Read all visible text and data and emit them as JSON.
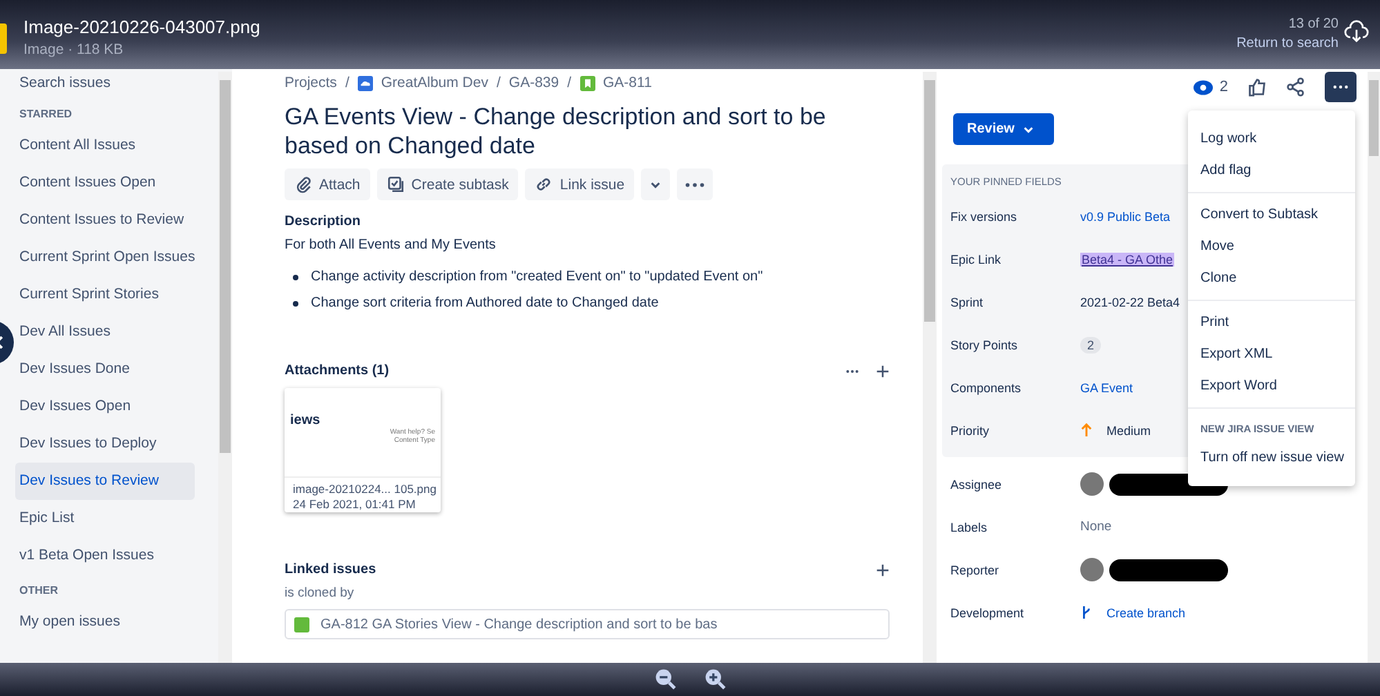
{
  "viewer": {
    "file_name": "Image-20210226-043007.png",
    "file_info": "Image · 118 KB",
    "position": "13 of 20",
    "return_link": "Return to search"
  },
  "sidebar": {
    "search": "Search issues",
    "sections": [
      {
        "heading": "STARRED",
        "items": [
          {
            "label": "Content All Issues",
            "selected": false
          },
          {
            "label": "Content Issues Open",
            "selected": false
          },
          {
            "label": "Content Issues to Review",
            "selected": false
          },
          {
            "label": "Current Sprint Open Issues",
            "selected": false
          },
          {
            "label": "Current Sprint Stories",
            "selected": false
          },
          {
            "label": "Dev All Issues",
            "selected": false
          },
          {
            "label": "Dev Issues Done",
            "selected": false
          },
          {
            "label": "Dev Issues Open",
            "selected": false
          },
          {
            "label": "Dev Issues to Deploy",
            "selected": false
          },
          {
            "label": "Dev Issues to Review",
            "selected": true
          },
          {
            "label": "Epic List",
            "selected": false
          },
          {
            "label": "v1 Beta Open Issues",
            "selected": false
          }
        ]
      },
      {
        "heading": "OTHER",
        "items": [
          {
            "label": "My open issues",
            "selected": false
          }
        ]
      }
    ]
  },
  "breadcrumbs": [
    {
      "label": "Projects",
      "kind": "plain"
    },
    {
      "separator": "/",
      "label": "GreatAlbum Dev",
      "kind": "project"
    },
    {
      "separator": "/",
      "label": "GA-839",
      "kind": "plain"
    },
    {
      "separator": "/",
      "label": "GA-811",
      "kind": "story"
    }
  ],
  "issue": {
    "title": "GA Events View - Change description and sort to be based on Changed date",
    "actions": [
      {
        "label": "Attach",
        "kind": "attach"
      },
      {
        "label": "Create subtask",
        "kind": "subtask"
      },
      {
        "label": "Link issue",
        "kind": "link"
      }
    ],
    "description_heading": "Description",
    "description_intro": "For both All Events and My Events",
    "description_bullets": [
      "Change activity description from \"created Event on\" to \"updated Event on\"",
      "Change sort criteria from Authored date to Changed date"
    ],
    "attachments_heading": "Attachments (1)",
    "attachment": {
      "preview_heading": "iews",
      "preview_note": "Want help? Se",
      "preview_column": "Content Type",
      "file_name": "image-20210224... 105.png",
      "date": "24 Feb 2021, 01:41 PM"
    },
    "linked_heading": "Linked issues",
    "link_type": "is cloned by",
    "linked_issue": "GA-812  GA Stories View - Change description and sort to be bas"
  },
  "right": {
    "watchers": "2",
    "status_button": "Review",
    "pinned_heading": "YOUR PINNED FIELDS",
    "pinned_fields": [
      {
        "label": "Fix versions",
        "value": "v0.9 Public Beta",
        "kind": "link"
      },
      {
        "label": "Epic Link",
        "value": "Beta4 - GA Othe",
        "kind": "epic"
      },
      {
        "label": "Sprint",
        "value": "2021-02-22 Beta4",
        "kind": "text"
      },
      {
        "label": "Story Points",
        "value": "2",
        "kind": "badge"
      },
      {
        "label": "Components",
        "value": "GA Event",
        "kind": "link"
      },
      {
        "label": "Priority",
        "value": "Medium",
        "kind": "priority"
      }
    ],
    "other_fields": [
      {
        "label": "Assignee",
        "kind": "person"
      },
      {
        "label": "Labels",
        "value": "None",
        "kind": "muted"
      },
      {
        "label": "Reporter",
        "kind": "person"
      },
      {
        "label": "Development",
        "value": "Create branch",
        "kind": "branch"
      }
    ]
  },
  "menu": [
    {
      "items": [
        "Log work",
        "Add flag"
      ]
    },
    {
      "items": [
        "Convert to Subtask",
        "Move",
        "Clone"
      ]
    },
    {
      "items": [
        "Print",
        "Export XML",
        "Export Word"
      ]
    },
    {
      "heading": "NEW JIRA ISSUE VIEW",
      "items": [
        "Turn off new issue view"
      ]
    }
  ]
}
